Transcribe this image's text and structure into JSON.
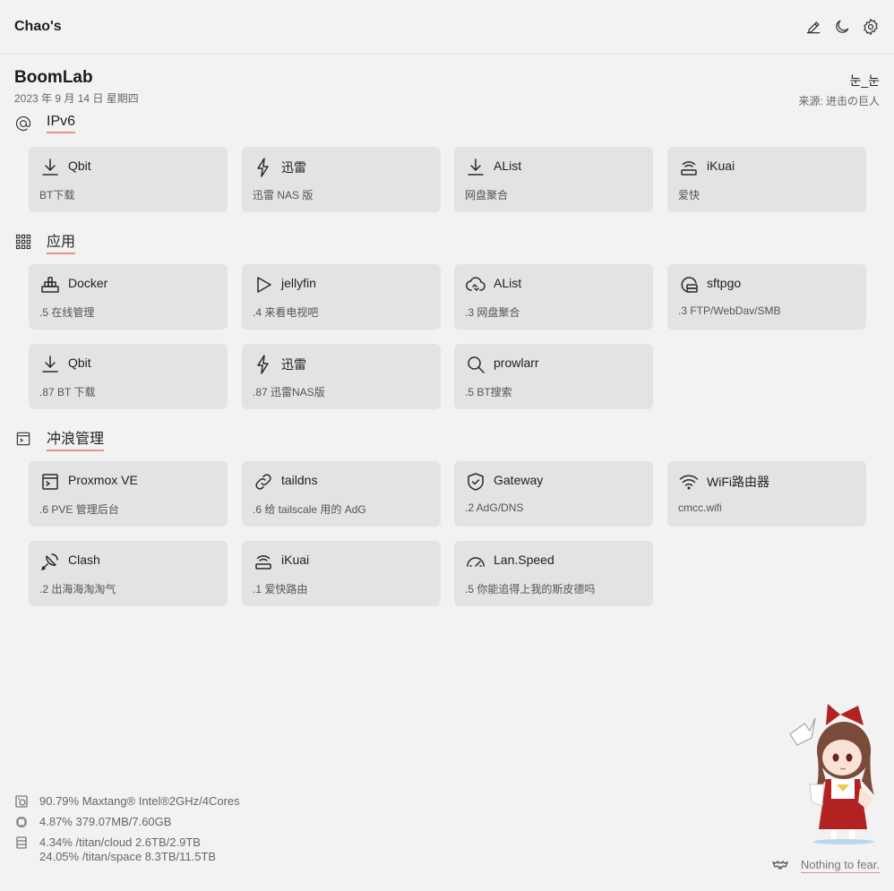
{
  "header": {
    "brand": "Chao's"
  },
  "greeting": {
    "title": "BoomLab",
    "date": "2023 年 9 月 14 日 星期四"
  },
  "quote": {
    "text": "눈_눈",
    "source": "来源: 进击の巨人"
  },
  "sections": [
    {
      "title": "IPv6",
      "icon": "at-icon"
    },
    {
      "title": "应用",
      "icon": "grid-icon"
    },
    {
      "title": "冲浪管理",
      "icon": "terminal-window-icon"
    }
  ],
  "ipv6": [
    {
      "name": "Qbit",
      "desc": "BT下载",
      "icon": "download-icon"
    },
    {
      "name": "迅雷",
      "desc": "迅雷 NAS 版",
      "icon": "lightning-icon"
    },
    {
      "name": "AList",
      "desc": "网盘聚合",
      "icon": "download-icon"
    },
    {
      "name": "iKuai",
      "desc": "爱快",
      "icon": "router-icon"
    }
  ],
  "apps": [
    {
      "name": "Docker",
      "desc": ".5 在线管理",
      "icon": "docker-icon"
    },
    {
      "name": "jellyfin",
      "desc": ".4 来看电视吧",
      "icon": "play-icon"
    },
    {
      "name": "AList",
      "desc": ".3 网盘聚合",
      "icon": "cloud-sync-icon"
    },
    {
      "name": "sftpgo",
      "desc": ".3 FTP/WebDav/SMB",
      "icon": "server-icon"
    },
    {
      "name": "Qbit",
      "desc": ".87 BT 下载",
      "icon": "download-icon"
    },
    {
      "name": "迅雷",
      "desc": ".87 迅雷NAS版",
      "icon": "lightning-icon"
    },
    {
      "name": "prowlarr",
      "desc": ".5 BT搜索",
      "icon": "search-icon"
    }
  ],
  "surf": [
    {
      "name": "Proxmox VE",
      "desc": ".6 PVE 管理后台",
      "icon": "terminal-window-icon"
    },
    {
      "name": "taildns",
      "desc": ".6 给 tailscale 用的 AdG",
      "icon": "link-icon"
    },
    {
      "name": "Gateway",
      "desc": ".2 AdG/DNS",
      "icon": "shield-check-icon"
    },
    {
      "name": "WiFi路由器",
      "desc": "cmcc.wifi",
      "icon": "wifi-icon"
    },
    {
      "name": "Clash",
      "desc": ".2 出海海淘淘气",
      "icon": "satellite-dish-icon"
    },
    {
      "name": "iKuai",
      "desc": ".1 爱快路由",
      "icon": "router-icon"
    },
    {
      "name": "Lan.Speed",
      "desc": ".5 你能追得上我的斯皮德吗",
      "icon": "speedometer-icon"
    }
  ],
  "stats": {
    "cpu": "90.79% Maxtang® Intel®2GHz/4Cores",
    "memory": "4.87% 379.07MB/7.60GB",
    "disk1": "4.34% /titan/cloud 2.6TB/2.9TB",
    "disk2": "24.05% /titan/space 8.3TB/11.5TB"
  },
  "footer": {
    "note": "Nothing to fear."
  },
  "colors": {
    "accent": "#e8908a",
    "card": "#e3e3e3",
    "background": "#f2f2f2"
  }
}
